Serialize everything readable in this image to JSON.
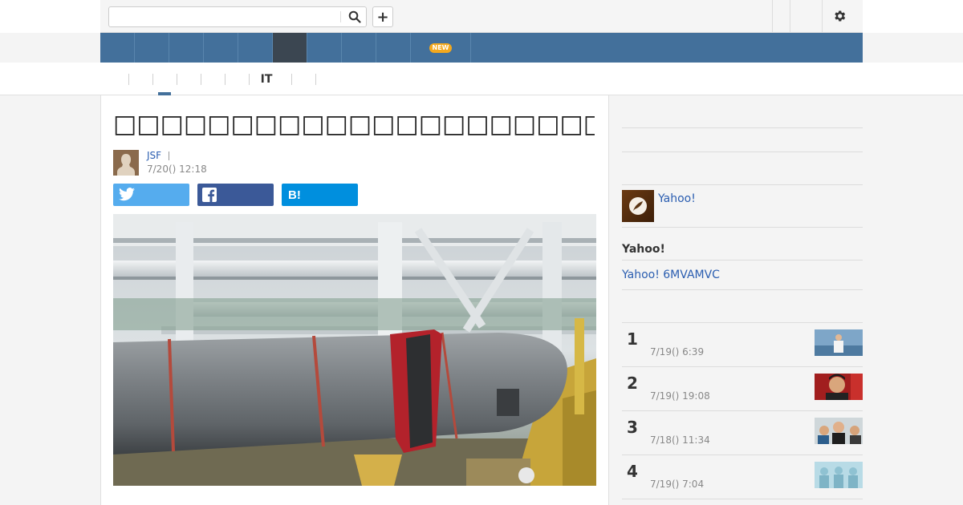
{
  "topbar": {
    "search_placeholder": "",
    "search_icon": "search-icon",
    "add_icon": "plus-icon",
    "settings_icon": "gear-icon",
    "add_label": "+"
  },
  "nav": {
    "tabs": [
      {
        "label": ""
      },
      {
        "label": ""
      },
      {
        "label": ""
      },
      {
        "label": ""
      },
      {
        "label": "",
        "active": true
      },
      {
        "label": ""
      },
      {
        "label": ""
      },
      {
        "label": ""
      },
      {
        "label": "",
        "badge": "NEW"
      }
    ],
    "color": "#43709b",
    "active_color": "#3b4651",
    "badge_color": "#f3a81e"
  },
  "subnav": {
    "items": [
      {
        "label": ""
      },
      {
        "label": "",
        "active": true
      },
      {
        "label": ""
      },
      {
        "label": ""
      },
      {
        "label": ""
      },
      {
        "label": "IT"
      },
      {
        "label": ""
      }
    ]
  },
  "article": {
    "headline": "□□□□□□□□□□□□□□□□□□□□□□□□□□□□□□□□□□□□□□□□□",
    "author_name": "JSF",
    "published": "7/20() 12:18",
    "share": {
      "twitter_icon": "twitter-icon",
      "facebook_icon": "facebook-icon",
      "hatena_label": "B!"
    },
    "image_icon": "torpedo-photo"
  },
  "sidebar": {
    "author_link": "Yahoo!",
    "heading": "Yahoo!",
    "sublink": "Yahoo! 6MVAMVC",
    "ranking": [
      {
        "rank": "1",
        "time": "7/19() 6:39"
      },
      {
        "rank": "2",
        "time": "7/19() 19:08"
      },
      {
        "rank": "3",
        "time": "7/18() 11:34"
      },
      {
        "rank": "4",
        "time": "7/19() 7:04"
      }
    ]
  }
}
